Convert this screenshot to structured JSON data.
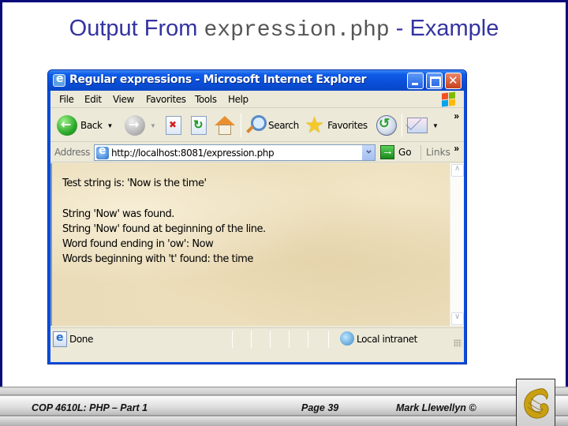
{
  "slide": {
    "title_prefix": "Output From ",
    "title_code": "expression.php",
    "title_suffix": " - Example",
    "footer": {
      "course": "COP 4610L:  PHP – Part 1",
      "page": "Page 39",
      "author": "Mark Llewellyn ©"
    },
    "logo": "ucf-pegasus-logo"
  },
  "browser": {
    "window_title": "Regular expressions - Microsoft Internet Explorer",
    "window_buttons": [
      "minimize",
      "maximize",
      "close"
    ],
    "menu": [
      "File",
      "Edit",
      "View",
      "Favorites",
      "Tools",
      "Help"
    ],
    "toolbar": {
      "back": "Back",
      "search": "Search",
      "favorites": "Favorites",
      "more": "»"
    },
    "address": {
      "label": "Address",
      "url": "http://localhost:8081/expression.php",
      "go": "Go",
      "links": "Links",
      "more": "»"
    },
    "content_lines": [
      "Test string is: 'Now is the time'",
      "String 'Now' was found.",
      "String 'Now' found at beginning of the line.",
      "Word found ending in 'ow': Now",
      "Words beginning with 't' found: the time"
    ],
    "status": {
      "text": "Done",
      "zone": "Local intranet"
    }
  }
}
